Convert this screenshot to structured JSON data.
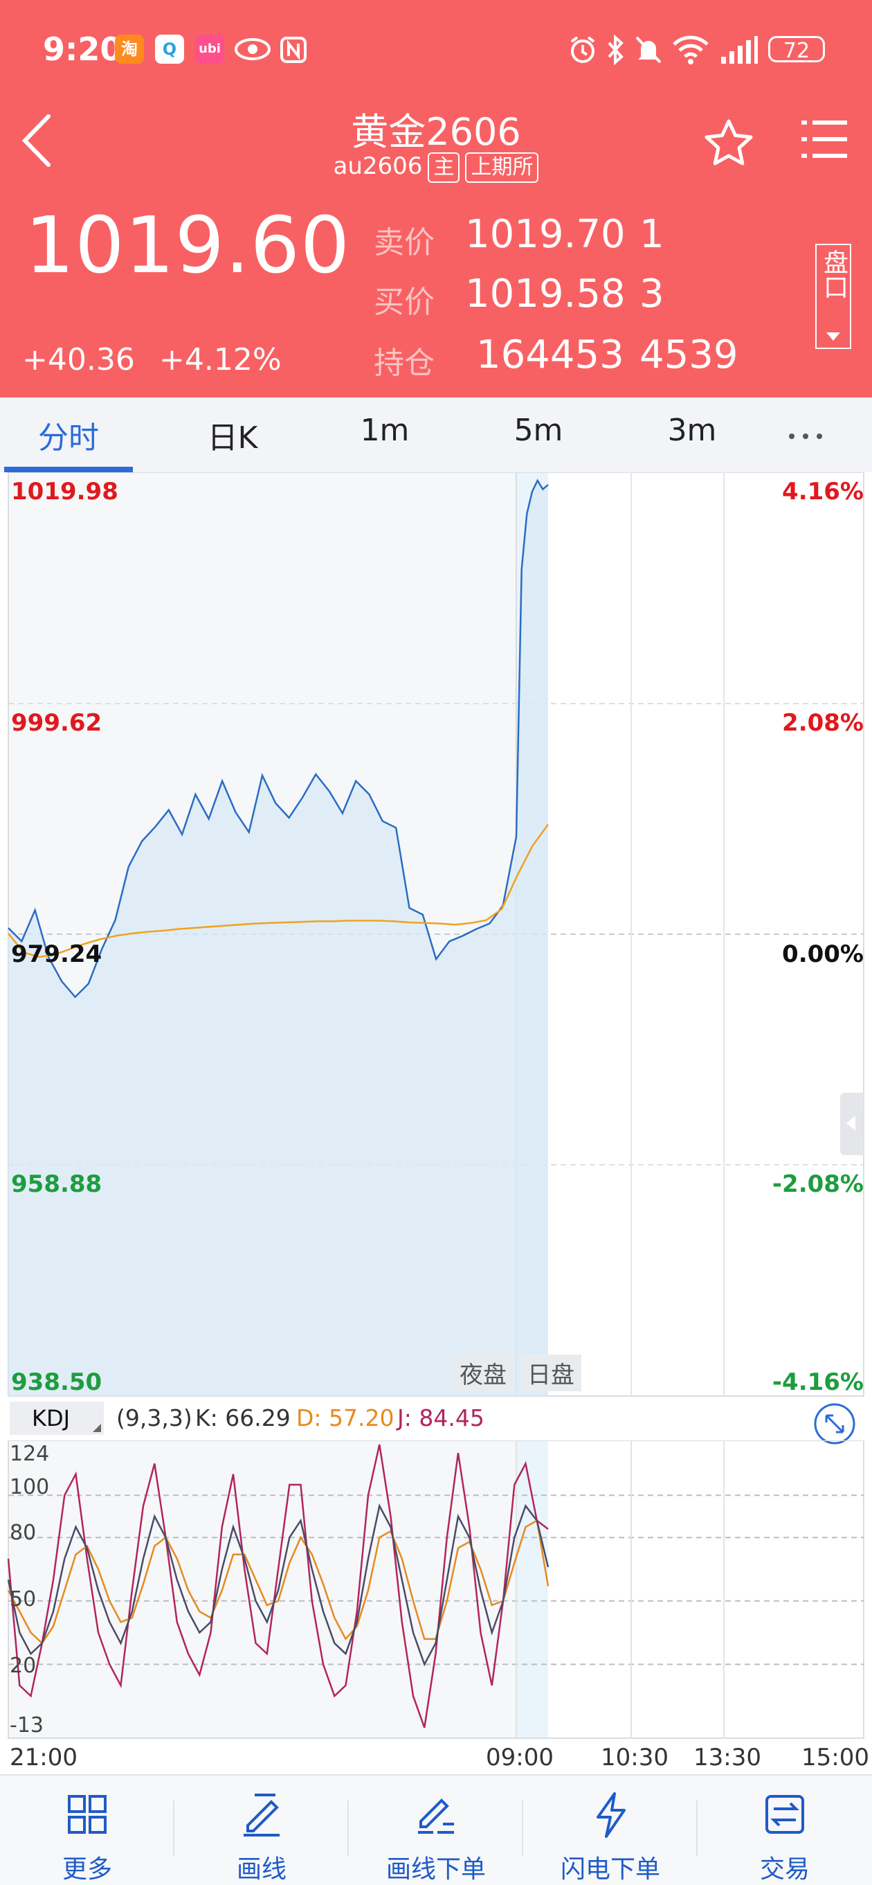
{
  "status_bar": {
    "time": "9:20",
    "battery": "72"
  },
  "header": {
    "title": "黄金2606",
    "code": "au2606",
    "tag_main": "主",
    "tag_exchange": "上期所",
    "last_price": "1019.60",
    "change": "+40.36",
    "change_pct": "+4.12%",
    "ask_label": "卖价",
    "ask_price": "1019.70",
    "ask_qty": "1",
    "bid_label": "买价",
    "bid_price": "1019.58",
    "bid_qty": "3",
    "oi_label": "持仓",
    "oi_value": "164453",
    "oi_change": "4539",
    "pankou_label": "盘口"
  },
  "tabs": [
    "分时",
    "日K",
    "1m",
    "5m",
    "3m"
  ],
  "chart_data": {
    "type": "line",
    "left_ticks": [
      "1019.98",
      "999.62",
      "979.24",
      "958.88",
      "938.50"
    ],
    "right_ticks": [
      "4.16%",
      "2.08%",
      "0.00%",
      "-2.08%",
      "-4.16%"
    ],
    "session_labels": [
      "夜盘",
      "日盘"
    ],
    "x_ticks": [
      "21:00",
      "09:00",
      "10:30",
      "13:30",
      "15:00"
    ],
    "price_series": [
      979.8,
      978.6,
      981.4,
      977.2,
      975.0,
      973.6,
      974.8,
      977.9,
      980.5,
      985.3,
      987.6,
      988.9,
      990.4,
      988.2,
      991.8,
      989.6,
      993.0,
      990.2,
      988.4,
      993.5,
      991.0,
      989.7,
      991.5,
      993.6,
      992.1,
      990.1,
      993.0,
      991.8,
      989.4,
      988.8,
      981.6,
      981.0,
      977.0,
      978.6,
      979.1,
      979.7,
      980.2,
      981.8,
      988.0,
      1012.0,
      1017.0,
      1019.0,
      1019.98,
      1019.2,
      1019.6
    ],
    "avg_series": [
      979.3,
      977.6,
      977.2,
      977.4,
      977.9,
      978.4,
      978.8,
      979.1,
      979.3,
      979.45,
      979.55,
      979.7,
      979.8,
      979.9,
      980.0,
      980.1,
      980.2,
      980.25,
      980.3,
      980.35,
      980.4,
      980.4,
      980.45,
      980.45,
      980.45,
      980.4,
      980.3,
      980.25,
      980.2,
      980.1,
      980.25,
      980.5,
      981.5,
      984.5,
      987.2,
      989.1
    ],
    "ylim": [
      938.5,
      1019.98
    ],
    "series": [
      {
        "name": "price"
      },
      {
        "name": "average"
      }
    ]
  },
  "kdj": {
    "label": "KDJ",
    "params": "(9,3,3)",
    "k_text": "K: 66.29",
    "d_text": "D: 57.20",
    "j_text": "J: 84.45",
    "k": 66.29,
    "d": 57.2,
    "j": 84.45,
    "y_ticks": [
      "124",
      "100",
      "80",
      "50",
      "20",
      "-13"
    ],
    "ylim": [
      -13,
      124
    ],
    "k_series": [
      60,
      35,
      25,
      30,
      45,
      70,
      85,
      75,
      55,
      40,
      30,
      45,
      70,
      90,
      80,
      60,
      45,
      35,
      40,
      65,
      85,
      70,
      50,
      40,
      55,
      80,
      88,
      65,
      45,
      30,
      25,
      40,
      70,
      95,
      85,
      60,
      35,
      20,
      30,
      60,
      90,
      80,
      55,
      35,
      50,
      80,
      95,
      88,
      66
    ],
    "d_series": [
      55,
      45,
      35,
      30,
      38,
      55,
      72,
      76,
      65,
      50,
      40,
      42,
      58,
      76,
      80,
      70,
      55,
      45,
      42,
      55,
      72,
      72,
      60,
      48,
      50,
      68,
      80,
      72,
      58,
      42,
      32,
      38,
      55,
      80,
      83,
      70,
      50,
      32,
      32,
      50,
      75,
      78,
      65,
      48,
      50,
      68,
      85,
      88,
      57
    ],
    "j_series": [
      70,
      10,
      5,
      30,
      60,
      100,
      110,
      70,
      35,
      20,
      10,
      55,
      95,
      115,
      80,
      40,
      25,
      15,
      35,
      85,
      110,
      65,
      30,
      25,
      65,
      105,
      105,
      50,
      20,
      5,
      10,
      45,
      100,
      124,
      90,
      40,
      5,
      -10,
      25,
      80,
      120,
      85,
      35,
      10,
      50,
      105,
      115,
      88,
      84
    ]
  },
  "nav": [
    "更多",
    "画线",
    "画线下单",
    "闪电下单",
    "交易"
  ],
  "colors": {
    "header_bg": "#f86163",
    "up": "#e0191f",
    "down": "#1d9d3f",
    "accent": "#2b6bd8",
    "price_line": "#2a6cc4",
    "avg_line": "#f0a21e",
    "k_line": "#4a4a6a",
    "d_line": "#e8891e",
    "j_line": "#b3245b"
  }
}
